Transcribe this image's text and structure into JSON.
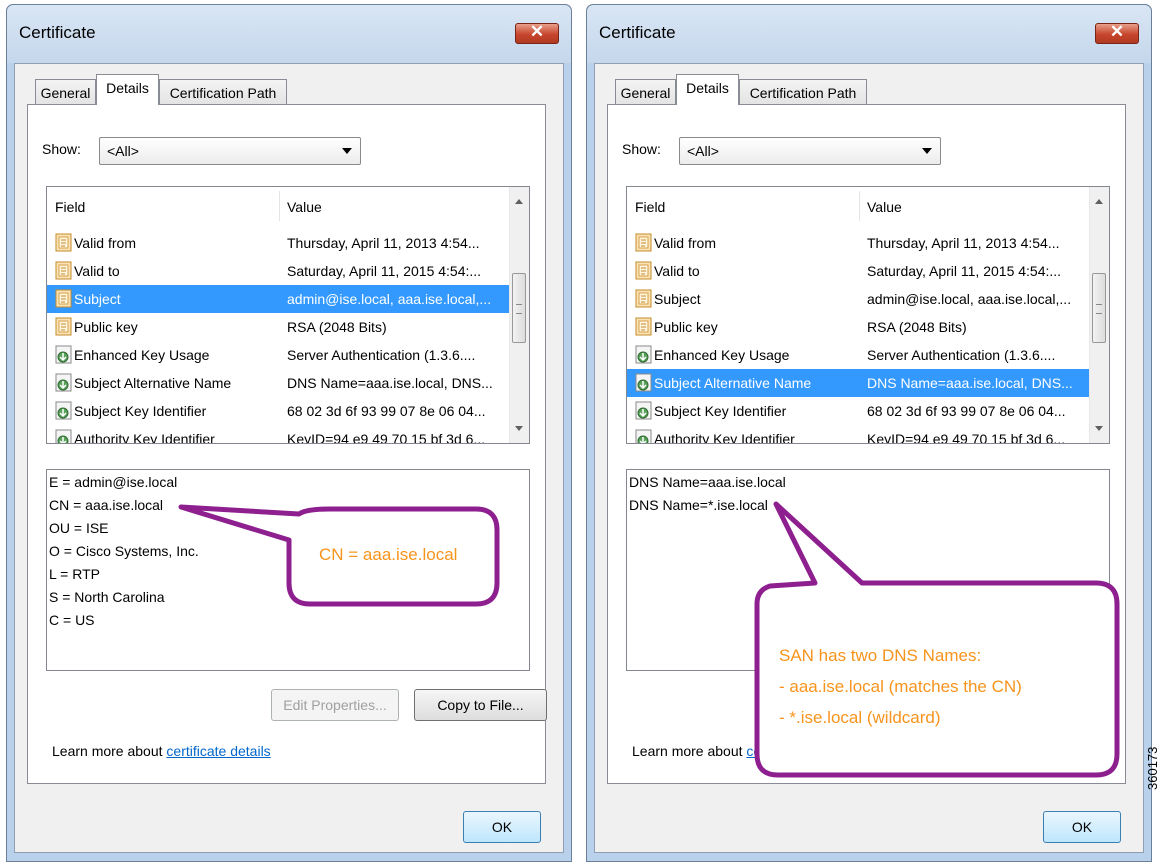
{
  "left_dialog": {
    "title": "Certificate",
    "close_label": "✕",
    "tabs": [
      {
        "label": "General"
      },
      {
        "label": "Details"
      },
      {
        "label": "Certification Path"
      }
    ],
    "show_label": "Show:",
    "show_value": "<All>",
    "col_field": "Field",
    "col_value": "Value",
    "rows": [
      {
        "field": "Valid from",
        "value": "Thursday, April 11, 2013 4:54...",
        "icon": "certificate-field-icon"
      },
      {
        "field": "Valid to",
        "value": "Saturday, April 11, 2015 4:54:...",
        "icon": "certificate-field-icon"
      },
      {
        "field": "Subject",
        "value": "admin@ise.local, aaa.ise.local,...",
        "icon": "certificate-field-icon",
        "selected": true
      },
      {
        "field": "Public key",
        "value": "RSA (2048 Bits)",
        "icon": "certificate-field-icon"
      },
      {
        "field": "Enhanced Key Usage",
        "value": "Server Authentication (1.3.6....",
        "icon": "extension-field-icon"
      },
      {
        "field": "Subject Alternative Name",
        "value": "DNS Name=aaa.ise.local, DNS...",
        "icon": "extension-field-icon"
      },
      {
        "field": "Subject Key Identifier",
        "value": "68 02 3d 6f 93 99 07 8e 06 04...",
        "icon": "extension-field-icon"
      },
      {
        "field": "Authority Key Identifier",
        "value": "KeyID=94 e9 49 70 15 bf 3d 6...",
        "icon": "extension-field-icon"
      }
    ],
    "detail_lines": [
      "E = admin@ise.local",
      "CN = aaa.ise.local",
      "OU = ISE",
      "O = Cisco Systems, Inc.",
      "L = RTP",
      "S = North Carolina",
      "C = US"
    ],
    "edit_properties_label": "Edit Properties...",
    "copy_to_file_label": "Copy to File...",
    "learn_prefix": "Learn more about ",
    "learn_link": "certificate details",
    "ok_label": "OK",
    "callout_text": "CN = aaa.ise.local"
  },
  "right_dialog": {
    "title": "Certificate",
    "close_label": "✕",
    "tabs": [
      {
        "label": "General"
      },
      {
        "label": "Details"
      },
      {
        "label": "Certification Path"
      }
    ],
    "show_label": "Show:",
    "show_value": "<All>",
    "col_field": "Field",
    "col_value": "Value",
    "rows": [
      {
        "field": "Valid from",
        "value": "Thursday, April 11, 2013 4:54...",
        "icon": "certificate-field-icon"
      },
      {
        "field": "Valid to",
        "value": "Saturday, April 11, 2015 4:54:...",
        "icon": "certificate-field-icon"
      },
      {
        "field": "Subject",
        "value": "admin@ise.local, aaa.ise.local,...",
        "icon": "certificate-field-icon"
      },
      {
        "field": "Public key",
        "value": "RSA (2048 Bits)",
        "icon": "certificate-field-icon"
      },
      {
        "field": "Enhanced Key Usage",
        "value": "Server Authentication (1.3.6....",
        "icon": "extension-field-icon"
      },
      {
        "field": "Subject Alternative Name",
        "value": "DNS Name=aaa.ise.local, DNS...",
        "icon": "extension-field-icon",
        "selected": true
      },
      {
        "field": "Subject Key Identifier",
        "value": "68 02 3d 6f 93 99 07 8e 06 04...",
        "icon": "extension-field-icon"
      },
      {
        "field": "Authority Key Identifier",
        "value": "KeyID=94 e9 49 70 15 bf 3d 6...",
        "icon": "extension-field-icon"
      }
    ],
    "detail_lines": [
      "DNS Name=aaa.ise.local",
      "DNS Name=*.ise.local"
    ],
    "learn_prefix": "Learn more about ",
    "learn_link": "certificate details",
    "ok_label": "OK",
    "callout_lines": [
      "SAN has two DNS Names:",
      "- aaa.ise.local (matches the CN)",
      "- *.ise.local (wildcard)"
    ]
  },
  "figure_id": "360173",
  "colors": {
    "callout_border": "#8e1f8f",
    "callout_text": "#f7941d",
    "selection": "#3399ff",
    "link": "#0066cc"
  }
}
